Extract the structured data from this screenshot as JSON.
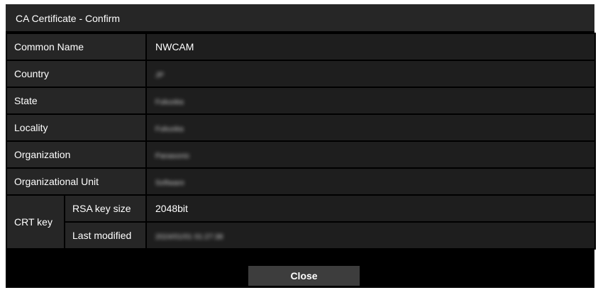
{
  "dialog": {
    "title": "CA Certificate - Confirm"
  },
  "fields": {
    "common_name": {
      "label": "Common Name",
      "value": "NWCAM"
    },
    "country": {
      "label": "Country",
      "value": "JP"
    },
    "state": {
      "label": "State",
      "value": "Fukuoka"
    },
    "locality": {
      "label": "Locality",
      "value": "Fukuoka"
    },
    "organization": {
      "label": "Organization",
      "value": "Panasonic"
    },
    "organizational_unit": {
      "label": "Organizational Unit",
      "value": "Software"
    }
  },
  "crt_key": {
    "label": "CRT key",
    "rsa_key_size": {
      "label": "RSA key size",
      "value": "2048bit"
    },
    "last_modified": {
      "label": "Last modified",
      "value": "2024/01/01 01:27:38"
    }
  },
  "footer": {
    "close_label": "Close"
  },
  "colors": {
    "background": "#000000",
    "label_cell": "#262626",
    "value_cell": "#1e1e1e",
    "button": "#3d3d3d",
    "text": "#ffffff"
  }
}
